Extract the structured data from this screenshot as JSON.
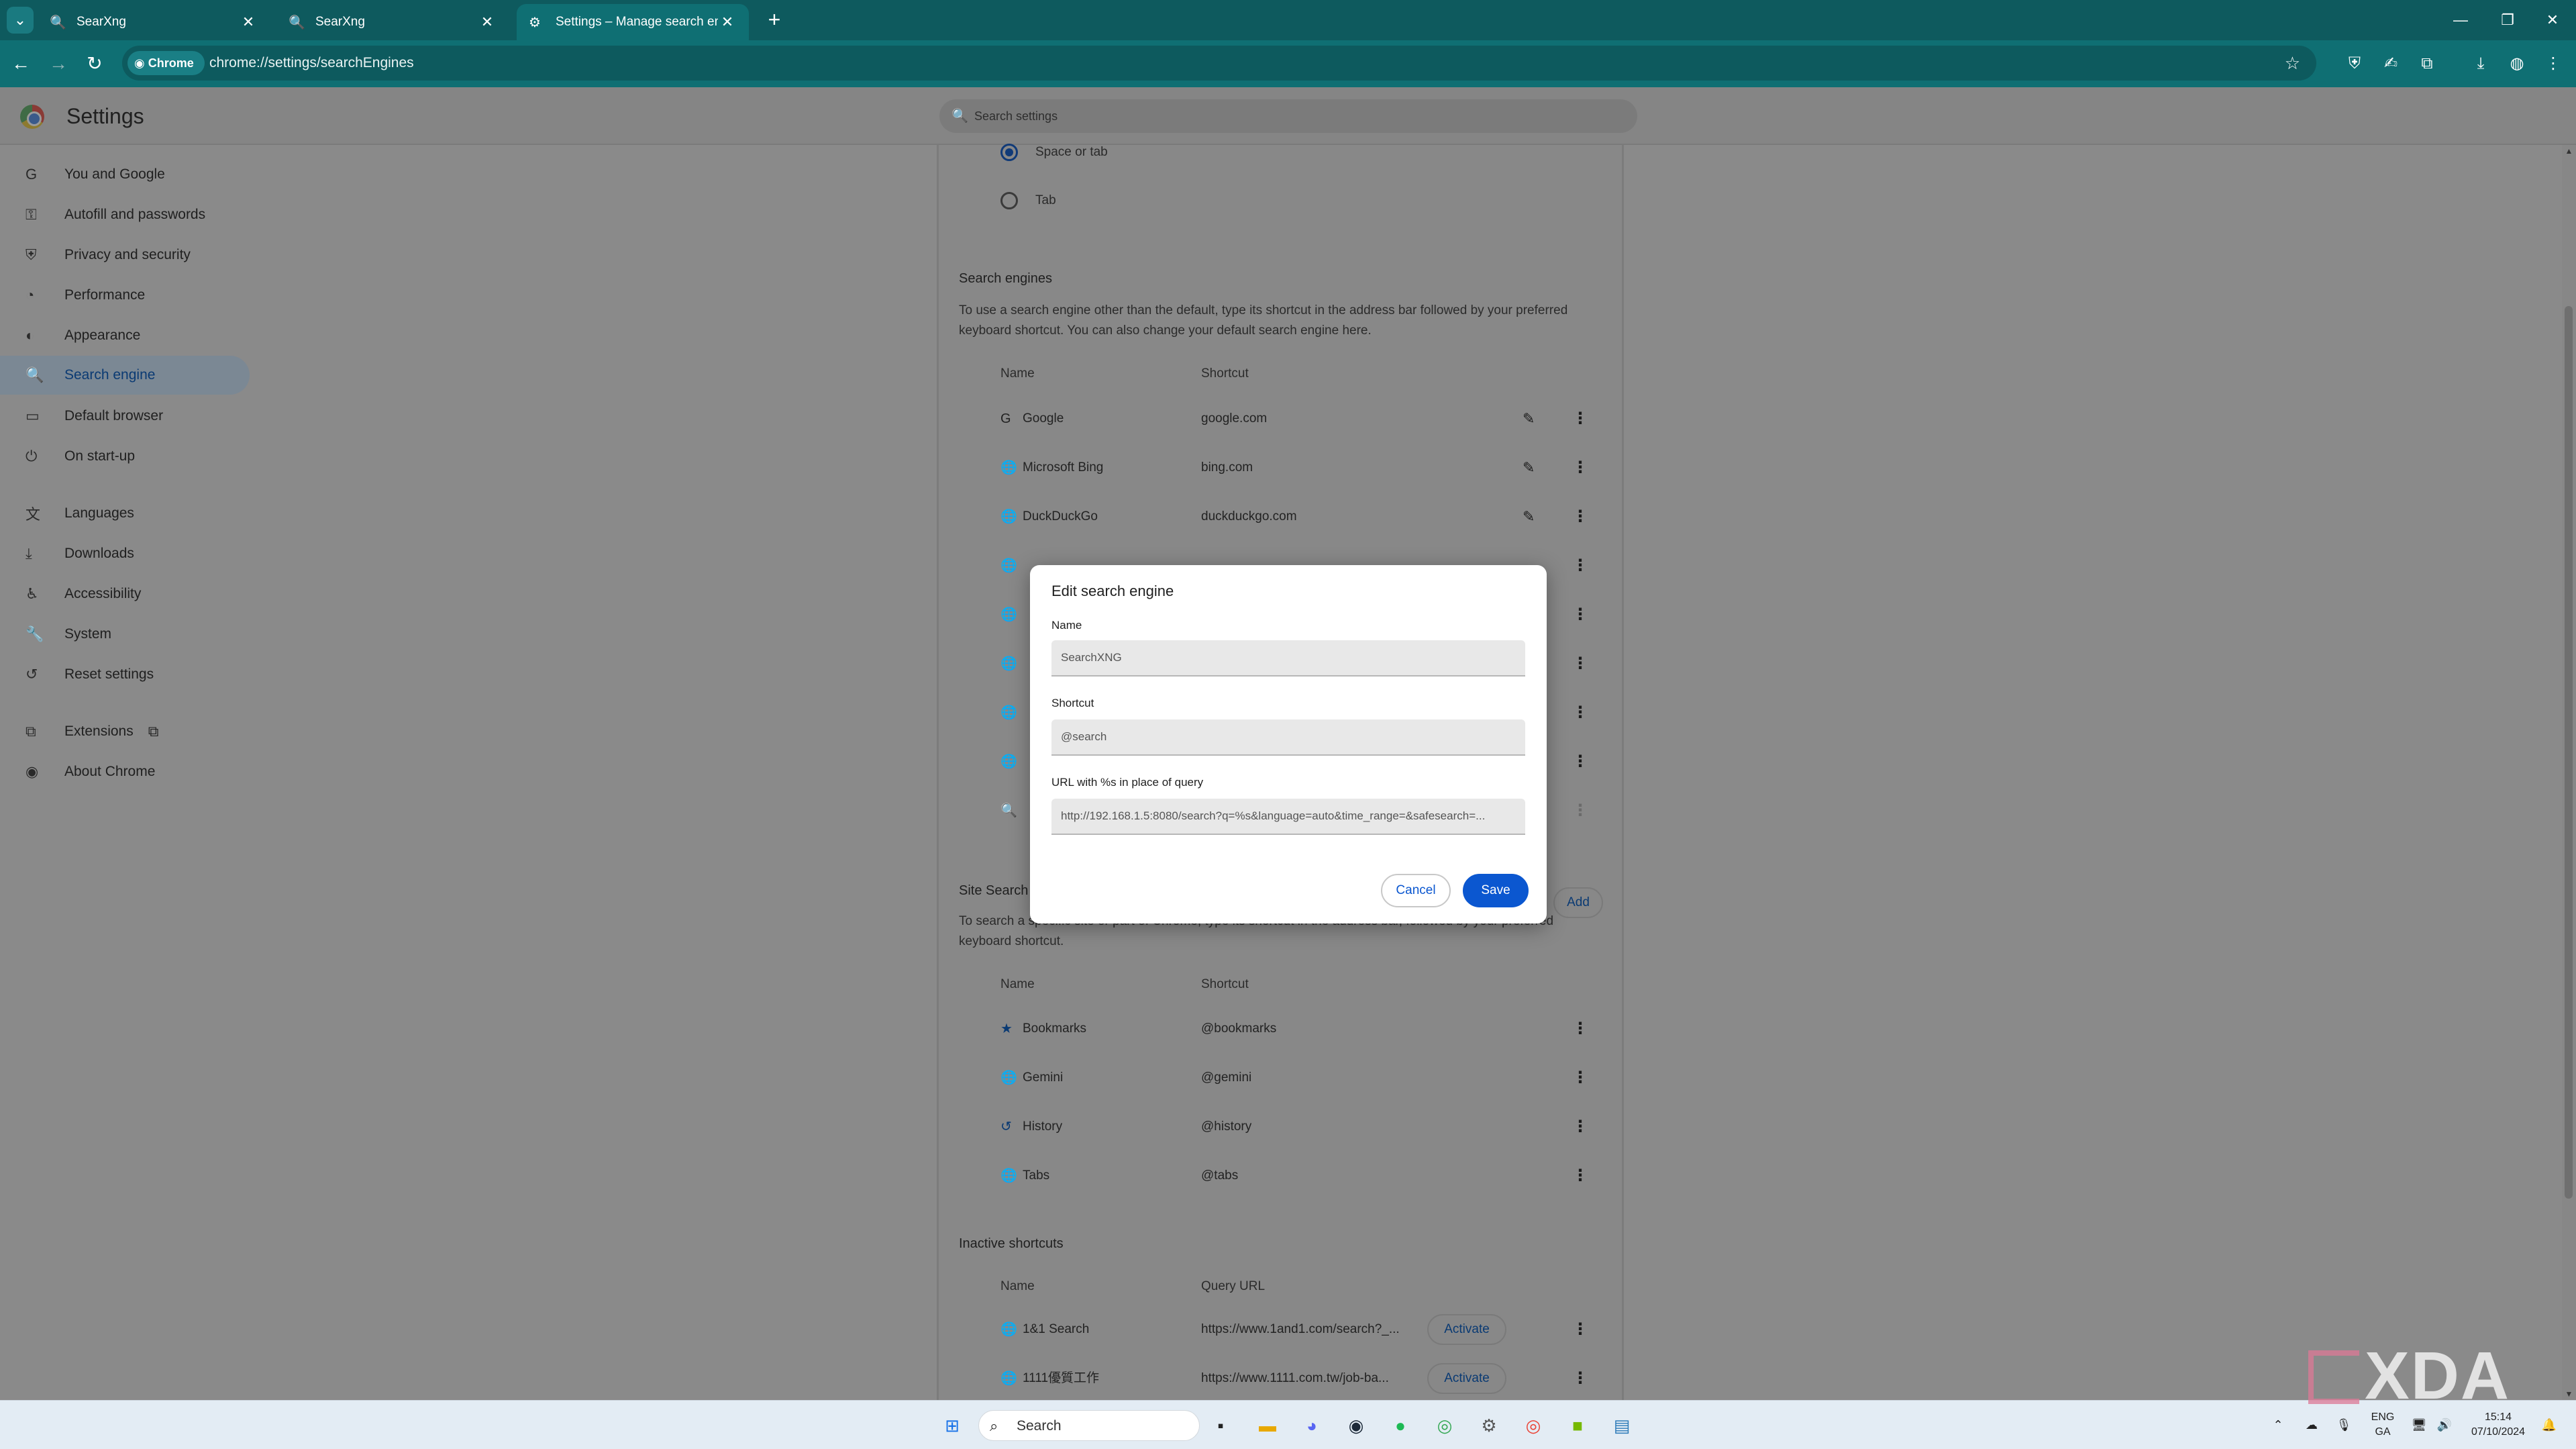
{
  "browser": {
    "tabs": [
      {
        "label": "SearXng",
        "active": false
      },
      {
        "label": "SearXng",
        "active": false
      },
      {
        "label": "Settings – Manage search engi",
        "active": true
      }
    ],
    "chip_label": "Chrome",
    "url": "chrome://settings/searchEngines",
    "colors": {
      "frame": "#0e5a5e",
      "toolbar": "#0f6f73"
    }
  },
  "settings": {
    "title": "Settings",
    "search_placeholder": "Search settings",
    "nav": [
      {
        "label": "You and Google",
        "icon": "google-g-icon"
      },
      {
        "label": "Autofill and passwords",
        "icon": "key-icon"
      },
      {
        "label": "Privacy and security",
        "icon": "shield-icon"
      },
      {
        "label": "Performance",
        "icon": "speedometer-icon"
      },
      {
        "label": "Appearance",
        "icon": "palette-icon"
      },
      {
        "label": "Search engine",
        "icon": "search-icon",
        "active": true
      },
      {
        "label": "Default browser",
        "icon": "browser-window-icon"
      },
      {
        "label": "On start-up",
        "icon": "power-icon"
      },
      {
        "label": "Languages",
        "icon": "translate-icon"
      },
      {
        "label": "Downloads",
        "icon": "download-icon"
      },
      {
        "label": "Accessibility",
        "icon": "accessibility-icon"
      },
      {
        "label": "System",
        "icon": "wrench-icon"
      },
      {
        "label": "Reset settings",
        "icon": "reset-icon"
      },
      {
        "label": "Extensions",
        "icon": "puzzle-icon"
      },
      {
        "label": "About Chrome",
        "icon": "chrome-icon"
      }
    ]
  },
  "main": {
    "shortcut_options": [
      {
        "label": "Space or tab",
        "selected": true
      },
      {
        "label": "Tab",
        "selected": false
      }
    ],
    "search_engines": {
      "heading": "Search engines",
      "description": "To use a search engine other than the default, type its shortcut in the address bar followed by your preferred keyboard shortcut. You can also change your default search engine here.",
      "col_name": "Name",
      "col_shortcut": "Shortcut",
      "rows": [
        {
          "name": "Google",
          "shortcut": "google.com"
        },
        {
          "name": "Microsoft Bing",
          "shortcut": "bing.com"
        },
        {
          "name": "DuckDuckGo",
          "shortcut": "duckduckgo.com"
        }
      ]
    },
    "site_search": {
      "heading": "Site Search",
      "description": "To search a specific site or part of Chrome, type its shortcut in the address bar, followed by your preferred keyboard shortcut.",
      "add_label": "Add",
      "col_name": "Name",
      "col_shortcut": "Shortcut",
      "rows": [
        {
          "name": "Bookmarks",
          "shortcut": "@bookmarks"
        },
        {
          "name": "Gemini",
          "shortcut": "@gemini"
        },
        {
          "name": "History",
          "shortcut": "@history"
        },
        {
          "name": "Tabs",
          "shortcut": "@tabs"
        }
      ]
    },
    "inactive": {
      "heading": "Inactive shortcuts",
      "col_name": "Name",
      "col_query": "Query URL",
      "activate_label": "Activate",
      "rows": [
        {
          "name": "1&1 Search",
          "url": "https://www.1and1.com/search?_..."
        },
        {
          "name": "1111優質工作",
          "url": "https://www.1111.com.tw/job-ba..."
        }
      ]
    }
  },
  "dialog": {
    "title": "Edit search engine",
    "name_label": "Name",
    "name_value": "SearchXNG",
    "shortcut_label": "Shortcut",
    "shortcut_value": "@search",
    "url_label": "URL with %s in place of query",
    "url_value": "http://192.168.1.5:8080/search?q=%s&language=auto&time_range=&safesearch=...",
    "cancel_label": "Cancel",
    "save_label": "Save",
    "accent": "#0b57d0"
  },
  "taskbar": {
    "search_label": "Search",
    "tray": {
      "lang_top": "ENG",
      "lang_bottom": "GA",
      "time": "15:14",
      "date": "07/10/2024"
    }
  },
  "watermark": "XDA"
}
